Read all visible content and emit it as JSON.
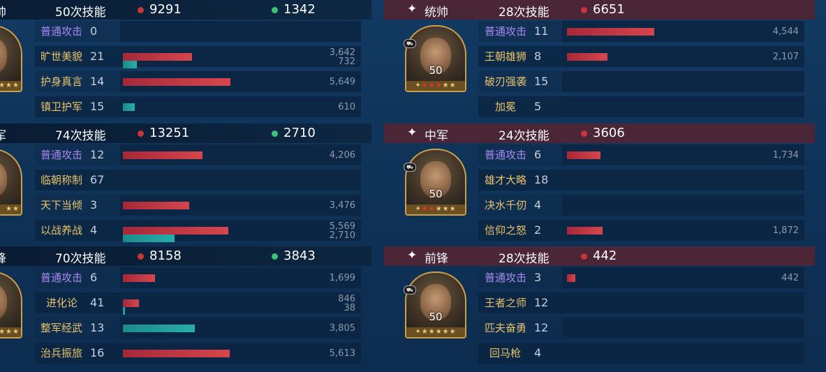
{
  "colors": {
    "damage": "#c8353c",
    "heal": "#3ec27a",
    "basic_attack_label": "#a987f0",
    "skill_label": "#e9c169",
    "damage_bar": "#d6464c",
    "heal_bar": "#27aeac"
  },
  "left": {
    "sections": [
      {
        "role": "帅",
        "casts": "50次技能",
        "damage": "9291",
        "heal": "1342",
        "portrait": {
          "level": "",
          "stars": "★★★"
        },
        "rows": [
          {
            "name": "普通攻击",
            "type": "basic",
            "count": "0",
            "dmg": null,
            "heal": null,
            "dmg_val": "",
            "heal_val": ""
          },
          {
            "name": "旷世美貌",
            "type": "skill",
            "count": "21",
            "dmg": 3642,
            "heal": 732,
            "dmg_val": "3,642",
            "heal_val": "732"
          },
          {
            "name": "护身真言",
            "type": "skill",
            "count": "14",
            "dmg": 5649,
            "heal": null,
            "dmg_val": "5,649",
            "heal_val": ""
          },
          {
            "name": "镇卫护军",
            "type": "skill",
            "count": "15",
            "dmg": null,
            "heal": 610,
            "dmg_val": "",
            "heal_val": "610"
          }
        ]
      },
      {
        "role": "军",
        "casts": "74次技能",
        "damage": "13251",
        "heal": "2710",
        "portrait": {
          "level": "",
          "stars": "★★"
        },
        "rows": [
          {
            "name": "普通攻击",
            "type": "basic",
            "count": "12",
            "dmg": 4206,
            "heal": null,
            "dmg_val": "4,206",
            "heal_val": ""
          },
          {
            "name": "临朝称制",
            "type": "skill",
            "count": "67",
            "dmg": null,
            "heal": null,
            "dmg_val": "",
            "heal_val": ""
          },
          {
            "name": "天下当倾",
            "type": "skill",
            "count": "3",
            "dmg": 3476,
            "heal": null,
            "dmg_val": "3,476",
            "heal_val": ""
          },
          {
            "name": "以战养战",
            "type": "skill",
            "count": "4",
            "dmg": 5569,
            "heal": 2710,
            "dmg_val": "5,569",
            "heal_val": "2,710"
          }
        ]
      },
      {
        "role": "锋",
        "casts": "70次技能",
        "damage": "8158",
        "heal": "3843",
        "portrait": {
          "level": "",
          "stars": "★★★"
        },
        "rows": [
          {
            "name": "普通攻击",
            "type": "basic",
            "count": "6",
            "dmg": 1699,
            "heal": null,
            "dmg_val": "1,699",
            "heal_val": ""
          },
          {
            "name": "进化论",
            "type": "skill",
            "count": "41",
            "dmg": 846,
            "heal": 38,
            "dmg_val": "846",
            "heal_val": "38"
          },
          {
            "name": "整军经武",
            "type": "skill",
            "count": "13",
            "dmg": null,
            "heal": 3805,
            "dmg_val": "",
            "heal_val": "3,805"
          },
          {
            "name": "治兵振旅",
            "type": "skill",
            "count": "16",
            "dmg": 5613,
            "heal": null,
            "dmg_val": "5,613",
            "heal_val": ""
          }
        ]
      }
    ]
  },
  "right": {
    "sections": [
      {
        "role": "统帅",
        "casts": "28次技能",
        "damage": "6651",
        "portrait": {
          "level": "50",
          "stars": "★★★★★",
          "red_stars": 3
        },
        "rows": [
          {
            "name": "普通攻击",
            "type": "basic",
            "count": "11",
            "dmg": 4544,
            "dmg_val": "4,544"
          },
          {
            "name": "王朝雄狮",
            "type": "skill",
            "count": "8",
            "dmg": 2107,
            "dmg_val": "2,107"
          },
          {
            "name": "破刃强袭",
            "type": "skill",
            "count": "15",
            "dmg": null,
            "dmg_val": ""
          },
          {
            "name": "加冕",
            "type": "skill",
            "count": "5",
            "dmg": null,
            "dmg_val": ""
          }
        ]
      },
      {
        "role": "中军",
        "casts": "24次技能",
        "damage": "3606",
        "portrait": {
          "level": "50",
          "stars": "★★★★★",
          "red_stars": 2
        },
        "rows": [
          {
            "name": "普通攻击",
            "type": "basic",
            "count": "6",
            "dmg": 1734,
            "dmg_val": "1,734"
          },
          {
            "name": "雄才大略",
            "type": "skill",
            "count": "18",
            "dmg": null,
            "dmg_val": ""
          },
          {
            "name": "决水千仞",
            "type": "skill",
            "count": "4",
            "dmg": null,
            "dmg_val": ""
          },
          {
            "name": "信仰之怒",
            "type": "skill",
            "count": "2",
            "dmg": 1872,
            "dmg_val": "1,872"
          }
        ]
      },
      {
        "role": "前锋",
        "casts": "28次技能",
        "damage": "442",
        "portrait": {
          "level": "50",
          "stars": "★★★★★",
          "red_stars": 0
        },
        "rows": [
          {
            "name": "普通攻击",
            "type": "basic",
            "count": "3",
            "dmg": 442,
            "dmg_val": "442"
          },
          {
            "name": "王者之师",
            "type": "skill",
            "count": "12",
            "dmg": null,
            "dmg_val": ""
          },
          {
            "name": "匹夫奋勇",
            "type": "skill",
            "count": "12",
            "dmg": null,
            "dmg_val": ""
          },
          {
            "name": "回马枪",
            "type": "skill",
            "count": "4",
            "dmg": null,
            "dmg_val": ""
          }
        ]
      }
    ]
  }
}
